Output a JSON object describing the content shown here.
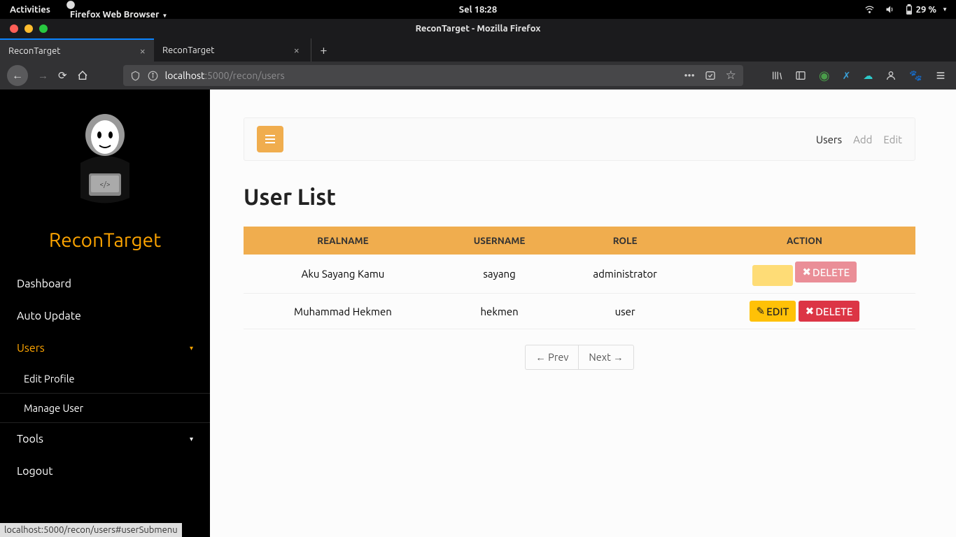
{
  "gnome": {
    "activities": "Activities",
    "app_menu": "Firefox Web Browser",
    "clock": "Sel 18:28",
    "battery": "29 %"
  },
  "firefox": {
    "window_title": "ReconTarget - Mozilla Firefox",
    "tabs": [
      {
        "label": "ReconTarget",
        "active": true
      },
      {
        "label": "ReconTarget",
        "active": false
      }
    ],
    "url_host": "localhost",
    "url_path": ":5000/recon/users",
    "status_link": "localhost:5000/recon/users#userSubmenu"
  },
  "sidebar": {
    "brand": "ReconTarget",
    "items": {
      "dashboard": "Dashboard",
      "autoupdate": "Auto Update",
      "users": "Users",
      "tools": "Tools",
      "logout": "Logout"
    },
    "users_sub": {
      "edit_profile": "Edit Profile",
      "manage_user": "Manage User"
    }
  },
  "topbar": {
    "crumbs": {
      "users": "Users",
      "add": "Add",
      "edit": "Edit"
    }
  },
  "page": {
    "title": "User List",
    "headers": {
      "realname": "REALNAME",
      "username": "USERNAME",
      "role": "ROLE",
      "action": "ACTION"
    },
    "rows": [
      {
        "realname": "Aku Sayang Kamu",
        "username": "sayang",
        "role": "administrator",
        "edit_label": "",
        "delete_label": "DELETE",
        "disabled": true
      },
      {
        "realname": "Muhammad Hekmen",
        "username": "hekmen",
        "role": "user",
        "edit_label": "EDIT",
        "delete_label": "DELETE",
        "disabled": false
      }
    ],
    "pager": {
      "prev": "← Prev",
      "next": "Next →"
    }
  }
}
